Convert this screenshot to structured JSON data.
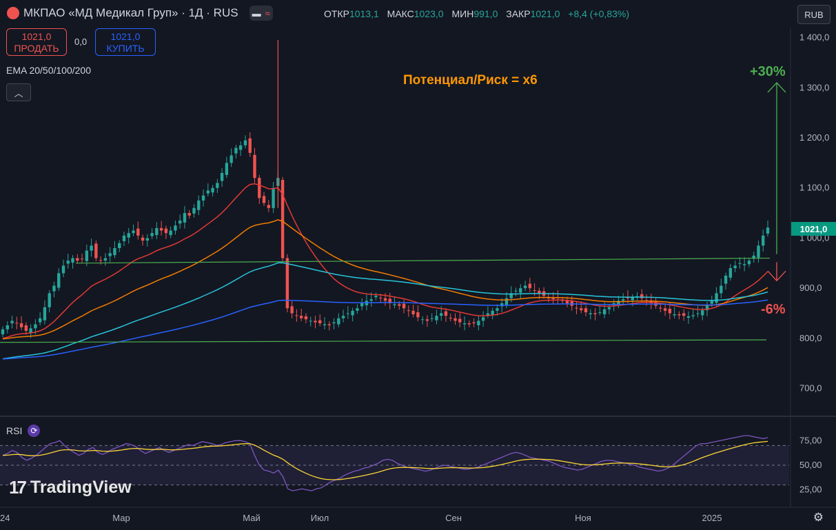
{
  "header": {
    "title": "МКПАО «МД Медикал Груп» · 1Д · RUS",
    "toggle_icons": [
      "minus-icon",
      "wave-icon"
    ],
    "ohlc": [
      {
        "label": "ОТКР",
        "value": "1013,1"
      },
      {
        "label": "МАКС",
        "value": "1023,0"
      },
      {
        "label": "МИН",
        "value": "991,0"
      },
      {
        "label": "ЗАКР",
        "value": "1021,0"
      },
      {
        "label": "",
        "value": "+8,4 (+0,83%)"
      }
    ],
    "currency": "RUB"
  },
  "trade": {
    "sell_price": "1021,0",
    "sell_label": "ПРОДАТЬ",
    "spread": "0,0",
    "buy_price": "1021,0",
    "buy_label": "КУПИТЬ"
  },
  "indicator_label": "EMA 20/50/100/200",
  "rsi_label": "RSI",
  "branding": "TradingView",
  "annotations": {
    "title": "Потенциал/Риск = x6",
    "up": "+30%",
    "down": "-6%"
  },
  "colors": {
    "up": "#26a69a",
    "down": "#ef5350",
    "ema20": "#e53935",
    "ema50": "#f57c00",
    "ema100": "#26c6da",
    "ema200": "#2962ff",
    "rsi": "#7e57c2",
    "rsi_ma": "#fdd835",
    "level": "#4caf50"
  },
  "chart_data": {
    "type": "candlestick",
    "price_axis": {
      "ticks": [
        "1 400,0",
        "1 300,0",
        "1 200,0",
        "1 100,0",
        "1 000,0",
        "900,0",
        "800,0",
        "700,0"
      ],
      "range": [
        650,
        1420
      ]
    },
    "time_axis": {
      "ticks": [
        "24",
        "Мар",
        "Май",
        "Июл",
        "Сен",
        "Ноя",
        "2025"
      ]
    },
    "last_price": "1021,0",
    "levels": [
      {
        "name": "resistance",
        "value": 960
      },
      {
        "name": "support",
        "value": 797
      }
    ],
    "targets": {
      "up_pct": 30,
      "down_pct": -6,
      "up_target": 1310,
      "stop": 915
    },
    "series": [
      {
        "name": "Close",
        "values": [
          818,
          826,
          835,
          830,
          822,
          815,
          820,
          828,
          840,
          862,
          890,
          905,
          930,
          945,
          955,
          960,
          955,
          958,
          975,
          985,
          960,
          955,
          960,
          970,
          980,
          990,
          1005,
          1010,
          1015,
          1005,
          995,
          1000,
          1010,
          1020,
          1015,
          1010,
          1015,
          1025,
          1035,
          1050,
          1045,
          1060,
          1075,
          1085,
          1095,
          1100,
          1110,
          1130,
          1150,
          1165,
          1180,
          1185,
          1195,
          1170,
          1120,
          1080,
          1070,
          1060,
          1100,
          1120,
          960,
          860,
          850,
          845,
          840,
          838,
          835,
          832,
          830,
          828,
          826,
          832,
          840,
          845,
          850,
          855,
          860,
          870,
          875,
          878,
          885,
          880,
          875,
          870,
          868,
          865,
          860,
          855,
          848,
          842,
          838,
          835,
          840,
          845,
          850,
          845,
          840,
          835,
          832,
          830,
          828,
          830,
          835,
          842,
          850,
          855,
          860,
          870,
          880,
          890,
          895,
          900,
          905,
          900,
          895,
          890,
          885,
          880,
          878,
          880,
          875,
          870,
          865,
          860,
          856,
          852,
          850,
          848,
          852,
          858,
          862,
          870,
          875,
          878,
          880,
          882,
          884,
          880,
          875,
          870,
          865,
          860,
          855,
          850,
          848,
          846,
          845,
          844,
          846,
          850,
          856,
          865,
          875,
          890,
          905,
          925,
          940,
          945,
          950,
          948,
          955,
          965,
          985,
          1005,
          1021
        ]
      },
      {
        "name": "RSI",
        "values": [
          60,
          62,
          65,
          63,
          58,
          55,
          57,
          60,
          64,
          68,
          72,
          73,
          75,
          70,
          66,
          63,
          60,
          62,
          66,
          68,
          63,
          61,
          63,
          66,
          68,
          70,
          72,
          71,
          69,
          65,
          62,
          64,
          66,
          68,
          65,
          63,
          65,
          67,
          69,
          71,
          70,
          72,
          74,
          73,
          72,
          70,
          71,
          73,
          74,
          75,
          75,
          74,
          72,
          60,
          50,
          45,
          44,
          42,
          45,
          38,
          26,
          24,
          25,
          26,
          25,
          24,
          26,
          27,
          30,
          33,
          35,
          37,
          40,
          42,
          44,
          45,
          47,
          48,
          50,
          52,
          55,
          56,
          55,
          52,
          50,
          48,
          47,
          46,
          45,
          44,
          45,
          47,
          49,
          50,
          49,
          48,
          47,
          46,
          46,
          47,
          48,
          50,
          52,
          54,
          56,
          58,
          60,
          62,
          63,
          62,
          60,
          58,
          57,
          56,
          55,
          54,
          52,
          50,
          48,
          47,
          46,
          45,
          46,
          48,
          50,
          52,
          54,
          55,
          55,
          54,
          53,
          52,
          51,
          50,
          48,
          47,
          46,
          45,
          44,
          45,
          47,
          50,
          54,
          58,
          62,
          66,
          70,
          72,
          72,
          73,
          74,
          75,
          76,
          77,
          78,
          79,
          80,
          80,
          79,
          78,
          77,
          78
        ]
      }
    ]
  }
}
